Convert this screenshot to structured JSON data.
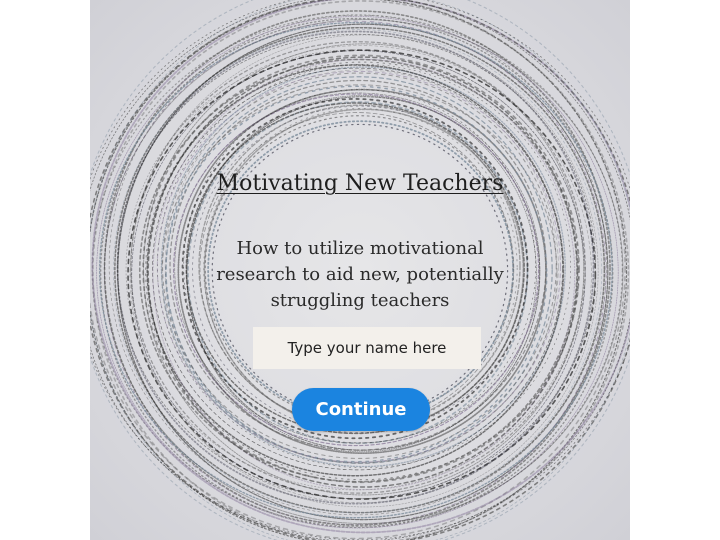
{
  "slide": {
    "title": "Motivating New Teachers",
    "subtitle": "How to utilize motivational research to aid new, potentially struggling teachers",
    "name_input": {
      "placeholder": "Type your name here",
      "value": ""
    },
    "continue_label": "Continue",
    "colors": {
      "button": "#1b84e0",
      "input_background": "#f3f0eb",
      "background": "#dedee2"
    },
    "background_icon": "concentric-rings-pattern"
  }
}
